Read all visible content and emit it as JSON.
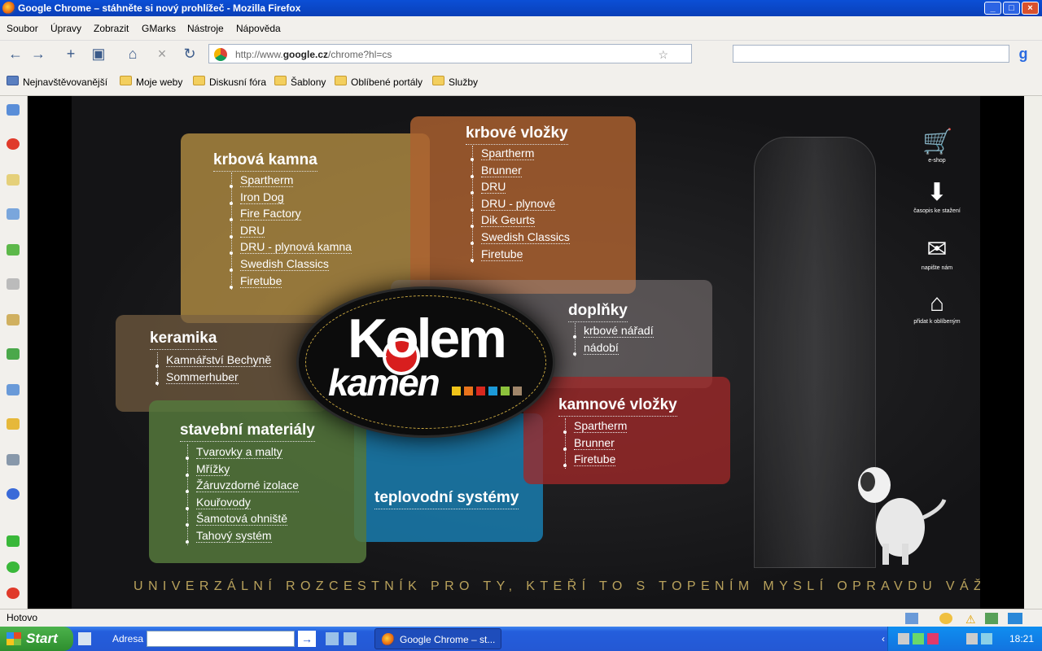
{
  "window": {
    "title": "Google Chrome – stáhněte si nový prohlížeč - Mozilla Firefox"
  },
  "menu": [
    "Soubor",
    "Úpravy",
    "Zobrazit",
    "GMarks",
    "Nástroje",
    "Nápověda"
  ],
  "nav": {
    "url_prefix": "http://www.",
    "url_domain": "google.cz",
    "url_path": "/chrome?hl=cs"
  },
  "bookmarks": [
    "Nejnavštěvovanější",
    "Moje weby",
    "Diskusní fóra",
    "Šablony",
    "Oblíbené portály",
    "Služby"
  ],
  "site": {
    "panels": {
      "kamna": {
        "title": "krbová kamna",
        "items": [
          "Spartherm",
          "Iron Dog",
          "Fire Factory",
          "DRU",
          "DRU - plynová kamna",
          "Swedish Classics",
          "Firetube"
        ]
      },
      "vlozky": {
        "title": "krbové vložky",
        "items": [
          "Spartherm",
          "Brunner",
          "DRU",
          "DRU - plynové",
          "Dik Geurts",
          "Swedish Classics",
          "Firetube"
        ]
      },
      "doplnky": {
        "title": "doplňky",
        "items": [
          "krbové nářadí",
          "nádobí"
        ]
      },
      "keramika": {
        "title": "keramika",
        "items": [
          "Kamnářství Bechyně",
          "Sommerhuber"
        ]
      },
      "stavebni": {
        "title": "stavební materiály",
        "items": [
          "Tvarovky a malty",
          "Mřížky",
          "Žáruvzdorné izolace",
          "Kouřovody",
          "Šamotová ohniště",
          "Tahový systém"
        ]
      },
      "teplo": {
        "title": "teplovodní systémy"
      },
      "kamnove": {
        "title": "kamnové vložky",
        "items": [
          "Spartherm",
          "Brunner",
          "Firetube"
        ]
      }
    },
    "logo": {
      "line1": "Kolem",
      "line2": "kamen"
    },
    "logo_colors": [
      "#f0c419",
      "#e8731c",
      "#d8281e",
      "#1c9ad8",
      "#8cc23c",
      "#a0866a"
    ],
    "tagline": "UNIVERZÁLNÍ ROZCESTNÍK PRO TY, KTEŘÍ TO S TOPENÍM MYSLÍ OPRAVDU VÁŽNĚ",
    "right_icons": [
      {
        "icon": "cart-icon",
        "label": "e-shop"
      },
      {
        "icon": "download-icon",
        "label": "časopis ke stažení"
      },
      {
        "icon": "mail-icon",
        "label": "napište nám"
      },
      {
        "icon": "home-icon",
        "label": "přidat k oblíbeným"
      }
    ]
  },
  "status": "Hotovo",
  "taskbar": {
    "start": "Start",
    "address_label": "Adresa",
    "task": "Google Chrome – st...",
    "clock": "18:21"
  }
}
